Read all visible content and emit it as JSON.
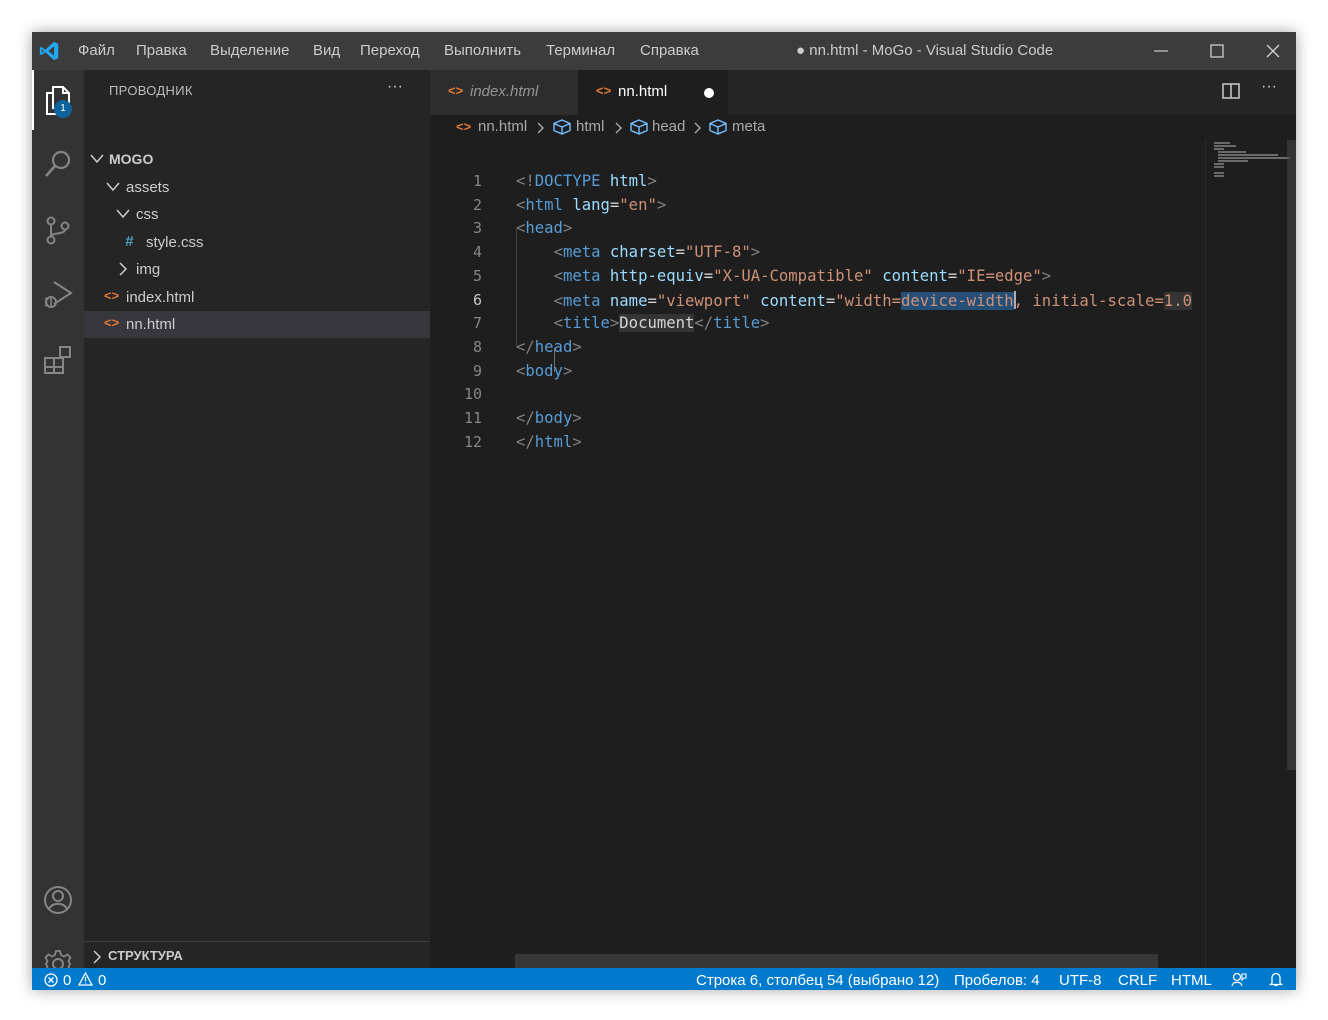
{
  "colors": {
    "accent": "#007acc",
    "title_bar": "#3c3c3c",
    "sidebar": "#252526",
    "editor": "#1e1e1e",
    "html_icon": "#e37933"
  },
  "menu": [
    "Файл",
    "Правка",
    "Выделение",
    "Вид",
    "Переход",
    "Выполнить",
    "Терминал",
    "Справка"
  ],
  "window_title": "● nn.html - MoGo - Visual Studio Code",
  "activity_bar": {
    "items": [
      "files-icon",
      "search-icon",
      "source-control-icon",
      "run-debug-icon",
      "extensions-icon"
    ],
    "bottom": [
      "account-icon",
      "gear-icon"
    ],
    "badge": "1"
  },
  "explorer": {
    "title": "ПРОВОДНИК",
    "more": "···",
    "tree": [
      {
        "label": "MOGO",
        "kind": "folder-open"
      },
      {
        "label": "assets",
        "kind": "folder-open"
      },
      {
        "label": "css",
        "kind": "folder-open"
      },
      {
        "label": "style.css",
        "kind": "css-file",
        "icon": "#"
      },
      {
        "label": "img",
        "kind": "folder-closed"
      },
      {
        "label": "index.html",
        "kind": "html-file",
        "icon": "<>"
      },
      {
        "label": "nn.html",
        "kind": "html-file",
        "icon": "<>",
        "selected": true
      }
    ],
    "outline": "СТРУКТУРА"
  },
  "tabs": [
    {
      "label": "index.html",
      "active": false,
      "preview": true
    },
    {
      "label": "nn.html",
      "active": true,
      "dirty": true
    }
  ],
  "breadcrumb": [
    "nn.html",
    "html",
    "head",
    "meta"
  ],
  "editor": {
    "line_numbers": [
      "1",
      "2",
      "3",
      "4",
      "5",
      "6",
      "7",
      "8",
      "9",
      "10",
      "11",
      "12"
    ],
    "current_line": "6",
    "lines": [
      [
        [
          "br",
          "<!"
        ],
        [
          "tag",
          "DOCTYPE"
        ],
        [
          "txt",
          " "
        ],
        [
          "attr",
          "html"
        ],
        [
          "br",
          ">"
        ]
      ],
      [
        [
          "br",
          "<"
        ],
        [
          "tag",
          "html"
        ],
        [
          "txt",
          " "
        ],
        [
          "attr",
          "lang"
        ],
        [
          "txt",
          "="
        ],
        [
          "str",
          "\"en\""
        ],
        [
          "br",
          ">"
        ]
      ],
      [
        [
          "br",
          "<"
        ],
        [
          "tag",
          "head"
        ],
        [
          "br",
          ">"
        ]
      ],
      [
        [
          "txt",
          "    "
        ],
        [
          "br",
          "<"
        ],
        [
          "tag",
          "meta"
        ],
        [
          "txt",
          " "
        ],
        [
          "attr",
          "charset"
        ],
        [
          "txt",
          "="
        ],
        [
          "str",
          "\"UTF-8\""
        ],
        [
          "br",
          ">"
        ]
      ],
      [
        [
          "txt",
          "    "
        ],
        [
          "br",
          "<"
        ],
        [
          "tag",
          "meta"
        ],
        [
          "txt",
          " "
        ],
        [
          "attr",
          "http-equiv"
        ],
        [
          "txt",
          "="
        ],
        [
          "str",
          "\"X-UA-Compatible\""
        ],
        [
          "txt",
          " "
        ],
        [
          "attr",
          "content"
        ],
        [
          "txt",
          "="
        ],
        [
          "str",
          "\"IE=edge\""
        ],
        [
          "br",
          ">"
        ]
      ],
      [
        [
          "txt",
          "    "
        ],
        [
          "br",
          "<"
        ],
        [
          "tag",
          "meta"
        ],
        [
          "txt",
          " "
        ],
        [
          "attr",
          "name"
        ],
        [
          "txt",
          "="
        ],
        [
          "str",
          "\"viewport\""
        ],
        [
          "txt",
          " "
        ],
        [
          "attr",
          "content"
        ],
        [
          "txt",
          "="
        ],
        [
          "str",
          "\"width="
        ],
        [
          "str-sel",
          "device-width"
        ],
        [
          "str",
          ", initial-scale="
        ],
        [
          "str-hl",
          "1.0"
        ]
      ],
      [
        [
          "txt",
          "    "
        ],
        [
          "br",
          "<"
        ],
        [
          "tag",
          "title"
        ],
        [
          "br",
          ">"
        ],
        [
          "txt-hl",
          "Document"
        ],
        [
          "br",
          "</"
        ],
        [
          "tag",
          "title"
        ],
        [
          "br",
          ">"
        ]
      ],
      [
        [
          "br",
          "</"
        ],
        [
          "tag",
          "head"
        ],
        [
          "br",
          ">"
        ]
      ],
      [
        [
          "br",
          "<"
        ],
        [
          "tag",
          "body"
        ],
        [
          "br",
          ">"
        ]
      ],
      [],
      [
        [
          "br",
          "</"
        ],
        [
          "tag",
          "body"
        ],
        [
          "br",
          ">"
        ]
      ],
      [
        [
          "br",
          "</"
        ],
        [
          "tag",
          "html"
        ],
        [
          "br",
          ">"
        ]
      ]
    ]
  },
  "status_bar": {
    "errors": "0",
    "warnings": "0",
    "position": "Строка 6, столбец 54 (выбрано 12)",
    "spaces": "Пробелов: 4",
    "encoding": "UTF-8",
    "eol": "CRLF",
    "language": "HTML"
  }
}
